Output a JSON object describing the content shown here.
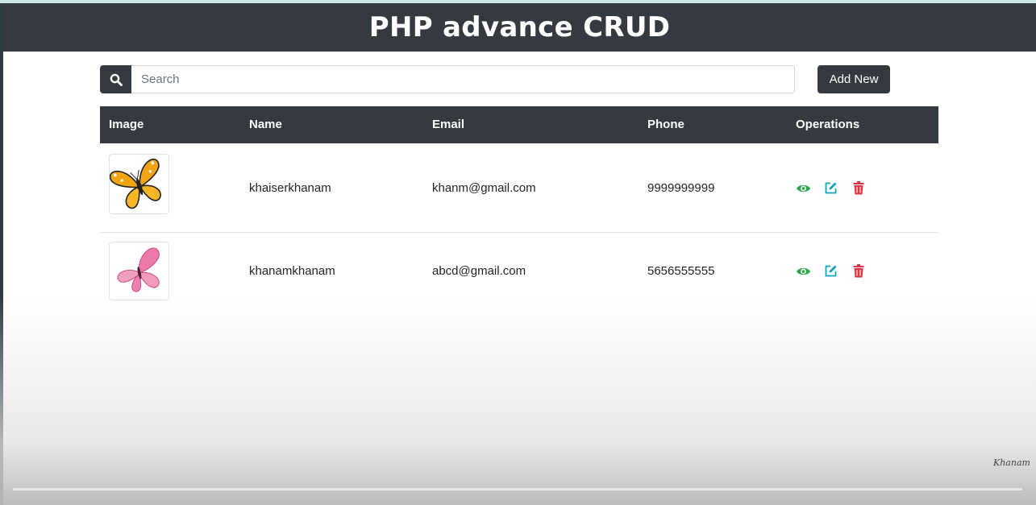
{
  "header": {
    "title": "PHP advance CRUD"
  },
  "search": {
    "placeholder": "Search"
  },
  "toolbar": {
    "add_label": "Add New"
  },
  "table": {
    "columns": [
      "Image",
      "Name",
      "Email",
      "Phone",
      "Operations"
    ],
    "rows": [
      {
        "image": "orange-butterfly",
        "name": "khaiserkhanam",
        "email": "khanm@gmail.com",
        "phone": "9999999999"
      },
      {
        "image": "pink-butterfly",
        "name": "khanamkhanam",
        "email": "abcd@gmail.com",
        "phone": "5656555555"
      }
    ]
  },
  "icons": {
    "search": "search-icon",
    "view": "eye-icon",
    "edit": "edit-icon",
    "delete": "trash-icon"
  },
  "colors": {
    "header_bg": "#343a40",
    "view": "#28a745",
    "edit": "#17a2b8",
    "delete": "#dc3545"
  },
  "watermark": "Khanam"
}
